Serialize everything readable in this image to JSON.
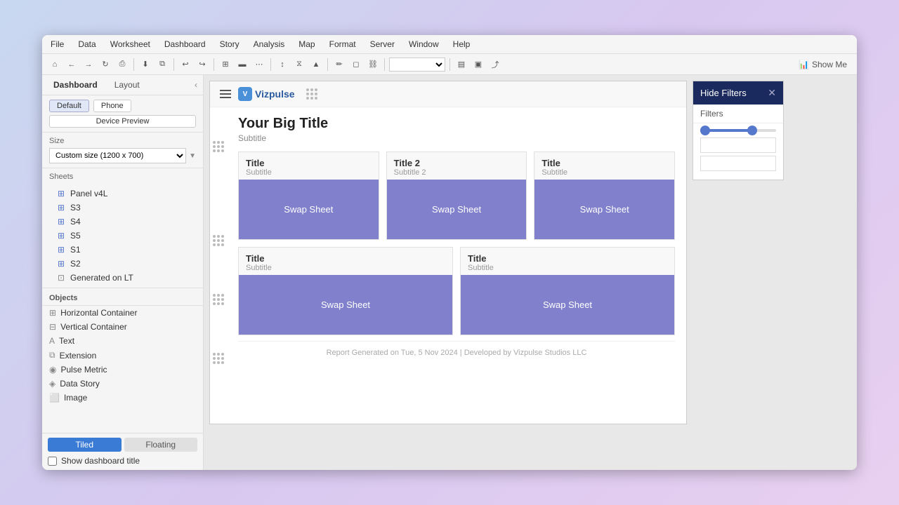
{
  "menu": {
    "items": [
      "File",
      "Data",
      "Worksheet",
      "Dashboard",
      "Story",
      "Analysis",
      "Map",
      "Format",
      "Server",
      "Window",
      "Help"
    ]
  },
  "toolbar": {
    "show_me_label": "Show Me"
  },
  "sidebar": {
    "tabs": [
      {
        "label": "Dashboard",
        "active": true
      },
      {
        "label": "Layout",
        "active": false
      }
    ],
    "size_section": {
      "title": "Size",
      "select_value": "Custom size (1200 x 700)"
    },
    "device_buttons": [
      {
        "label": "Default",
        "active": true
      },
      {
        "label": "Phone",
        "active": false
      }
    ],
    "device_preview_label": "Device Preview",
    "sheets_title": "Sheets",
    "sheets": [
      {
        "label": "Panel v4L",
        "type": "sheet"
      },
      {
        "label": "S3",
        "type": "sheet"
      },
      {
        "label": "S4",
        "type": "sheet"
      },
      {
        "label": "S5",
        "type": "sheet"
      },
      {
        "label": "S1",
        "type": "sheet"
      },
      {
        "label": "S2",
        "type": "sheet"
      },
      {
        "label": "Generated on LT",
        "type": "generated"
      }
    ],
    "objects_title": "Objects",
    "objects": [
      {
        "label": "Horizontal Container",
        "icon": "⊞"
      },
      {
        "label": "Vertical Container",
        "icon": "⊟"
      },
      {
        "label": "Text",
        "icon": "A"
      },
      {
        "label": "Extension",
        "icon": "⧉"
      },
      {
        "label": "Pulse Metric",
        "icon": "◉"
      },
      {
        "label": "Data Story",
        "icon": "◈"
      },
      {
        "label": "Image",
        "icon": "⬜"
      }
    ],
    "layout_buttons": [
      {
        "label": "Tiled",
        "active": true
      },
      {
        "label": "Floating",
        "active": false
      }
    ],
    "show_dashboard_title_label": "Show dashboard title"
  },
  "dashboard": {
    "title": "Your Big Title",
    "subtitle": "Subtitle",
    "logo_text": "Vizpulse",
    "vizrow1": [
      {
        "title": "Title",
        "subtitle": "Subtitle",
        "swap_label": "Swap Sheet"
      },
      {
        "title": "Title 2",
        "subtitle": "Subtitle 2",
        "swap_label": "Swap Sheet"
      },
      {
        "title": "Title",
        "subtitle": "Subtitle",
        "swap_label": "Swap Sheet"
      }
    ],
    "vizrow2": [
      {
        "title": "Title",
        "subtitle": "Subtitle",
        "swap_label": "Swap Sheet"
      },
      {
        "title": "Title",
        "subtitle": "Subtitle",
        "swap_label": "Swap Sheet"
      }
    ],
    "footer": "Report Generated on Tue, 5 Nov 2024  |  Developed by Vizpulse Studios LLC"
  },
  "filters_panel": {
    "hide_filters_label": "Hide Filters",
    "filters_label": "Filters"
  }
}
